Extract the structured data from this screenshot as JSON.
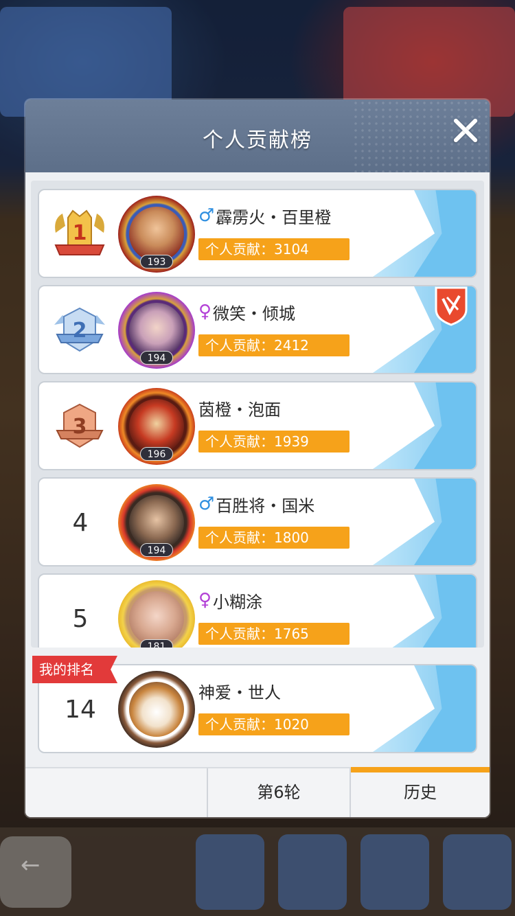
{
  "modal": {
    "title": "个人贡献榜"
  },
  "contribution_label": "个人贡献：",
  "leaderboard": [
    {
      "rank": "1",
      "name": "霹雳火・百里橙",
      "gender": "male",
      "gender_symbol": "♂",
      "level": "193",
      "contribution": "个人贡献：3104",
      "medal": "gold"
    },
    {
      "rank": "2",
      "name": "微笑・倾城",
      "gender": "female",
      "gender_symbol": "♀",
      "level": "194",
      "contribution": "个人贡献：2412",
      "medal": "silver"
    },
    {
      "rank": "3",
      "name": "茵橙・泡面",
      "gender": "none",
      "gender_symbol": "",
      "level": "196",
      "contribution": "个人贡献：1939",
      "medal": "bronze"
    },
    {
      "rank": "4",
      "name": "百胜将・国米",
      "gender": "male",
      "gender_symbol": "♂",
      "level": "194",
      "contribution": "个人贡献：1800",
      "medal": "none"
    },
    {
      "rank": "5",
      "name": "小糊涂",
      "gender": "female",
      "gender_symbol": "♀",
      "level": "181",
      "contribution": "个人贡献：1765",
      "medal": "none"
    }
  ],
  "my_rank": {
    "tag": "我的排名",
    "rank": "14",
    "name": "神爱・世人",
    "contribution": "个人贡献：1020"
  },
  "footer": {
    "round_tab": "第6轮",
    "history_tab": "历史"
  },
  "colors": {
    "header": "#6d7f99",
    "contribution_bar": "#f6a21a",
    "male": "#2f8fe0",
    "female": "#b240d6",
    "my_rank_tag": "#e23a3a",
    "card_deco": "#7cc7f0"
  }
}
